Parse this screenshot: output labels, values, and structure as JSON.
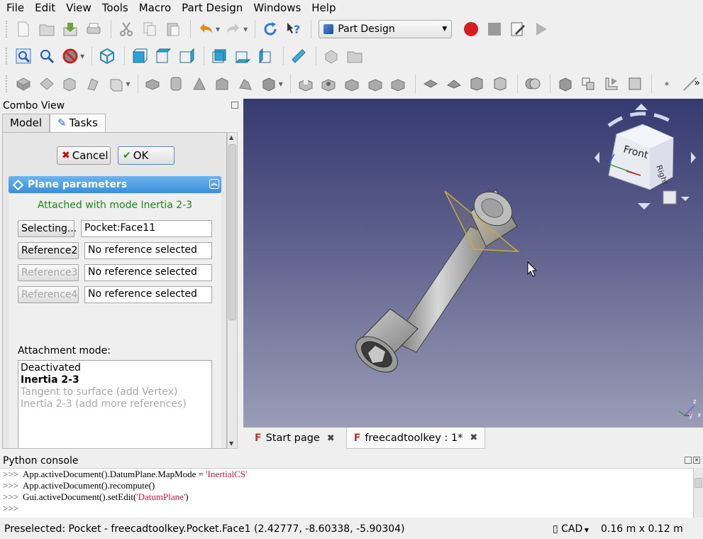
{
  "menu": [
    "File",
    "Edit",
    "View",
    "Tools",
    "Macro",
    "Part Design",
    "Windows",
    "Help"
  ],
  "workbench": "Part Design",
  "toolbar_more": "»",
  "combo": {
    "title": "Combo View",
    "tabs": [
      {
        "label": "Model"
      },
      {
        "label": "Tasks"
      }
    ],
    "cancel_label": "Cancel",
    "ok_label": "OK",
    "panel_title": "Plane parameters",
    "status": "Attached with mode Inertia 2-3",
    "references": [
      {
        "button": "Selecting...",
        "value": "Pocket:Face11",
        "enabled": true
      },
      {
        "button": "Reference2",
        "value": "No reference selected",
        "enabled": true
      },
      {
        "button": "Reference3",
        "value": "No reference selected",
        "enabled": false
      },
      {
        "button": "Reference4",
        "value": "No reference selected",
        "enabled": false
      }
    ],
    "mode_label": "Attachment mode:",
    "modes": [
      {
        "label": "Deactivated",
        "style": "normal"
      },
      {
        "label": "Inertia 2-3",
        "style": "bold"
      },
      {
        "label": "Tangent to surface (add Vertex)",
        "style": "gray"
      },
      {
        "label": "Inertia 2-3 (add more references)",
        "style": "gray"
      }
    ]
  },
  "view": {
    "navcube_face": "Front",
    "navcube_side": "Right",
    "axes": {
      "x": "x",
      "y": "y",
      "z": "z"
    }
  },
  "doc_tabs": [
    {
      "label": "Start page",
      "active": false
    },
    {
      "label": "freecadtoolkey : 1*",
      "active": true
    }
  ],
  "console": {
    "title": "Python console",
    "prompt": ">>>",
    "lines": [
      {
        "code": "App.activeDocument().DatumPlane.MapMode = ",
        "str": "'InertialCS'"
      },
      {
        "code": "App.activeDocument().recompute()",
        "str": ""
      },
      {
        "code": "Gui.activeDocument().setEdit(",
        "str": "'DatumPlane'",
        "tail": ")"
      },
      {
        "code": "",
        "str": ""
      }
    ]
  },
  "status": {
    "preselected": "Preselected: Pocket - freecadtoolkey.Pocket.Face1 (2.42777, -8.60338, -5.90304)",
    "nav_style": "CAD",
    "dimensions": "0.16 m x 0.12 m"
  },
  "colors": {
    "accent": "#3b8fd8",
    "status_ok": "#1a8a1a",
    "console_string": "#c0143c",
    "record": "#d81e1e"
  }
}
